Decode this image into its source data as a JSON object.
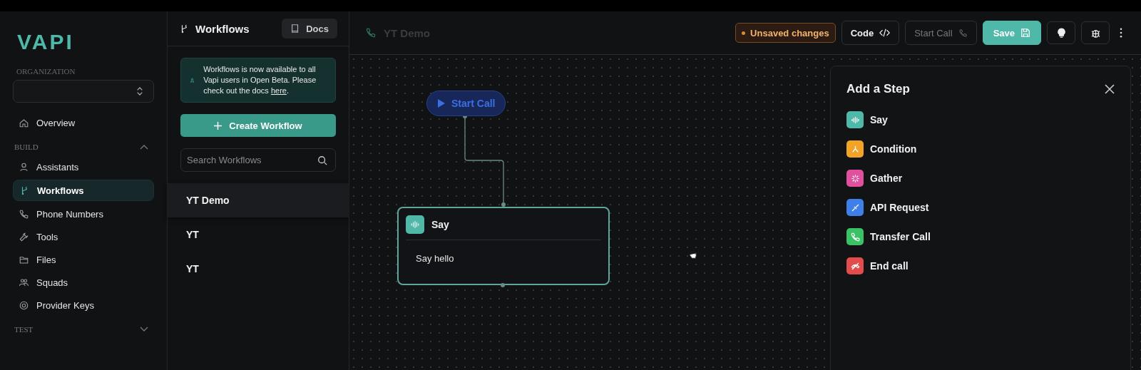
{
  "logo": "VAPI",
  "sidebar": {
    "organization_label": "ORGANIZATION",
    "top_items": [
      {
        "label": "Overview",
        "selected": false
      }
    ],
    "sections": [
      {
        "title": "BUILD",
        "expanded": true,
        "items": [
          {
            "label": "Assistants",
            "selected": false
          },
          {
            "label": "Workflows",
            "selected": true
          },
          {
            "label": "Phone Numbers",
            "selected": false
          },
          {
            "label": "Tools",
            "selected": false
          },
          {
            "label": "Files",
            "selected": false
          },
          {
            "label": "Squads",
            "selected": false
          },
          {
            "label": "Provider Keys",
            "selected": false
          }
        ]
      },
      {
        "title": "TEST",
        "expanded": false
      }
    ]
  },
  "workflows_panel": {
    "title": "Workflows",
    "docs_button": "Docs",
    "notice": {
      "text": "Workflows is now available to all Vapi users in Open Beta. Please check out the docs ",
      "link": "here",
      "after": "."
    },
    "create_button": "Create Workflow",
    "search": {
      "placeholder": "Search Workflows"
    },
    "items": [
      {
        "label": "YT Demo",
        "selected": true
      },
      {
        "label": "YT",
        "selected": false
      },
      {
        "label": "YT",
        "selected": false
      }
    ]
  },
  "header": {
    "title": "YT Demo",
    "status": "Unsaved changes",
    "buttons": [
      {
        "label": "Code",
        "kind": "code",
        "disabled": false
      },
      {
        "label": "Start Call",
        "kind": "call",
        "disabled": true
      },
      {
        "label": "Save",
        "kind": "save",
        "disabled": false
      }
    ]
  },
  "canvas": {
    "start_node": {
      "label": "Start Call"
    },
    "say_node": {
      "title": "Say",
      "body": "Say hello"
    }
  },
  "add_step": {
    "title": "Add a Step",
    "steps": [
      {
        "label": "Say",
        "color": "#4fb8a8"
      },
      {
        "label": "Condition",
        "color": "#f2a428"
      },
      {
        "label": "Gather",
        "color": "#e0509e"
      },
      {
        "label": "API Request",
        "color": "#3f7fe8"
      },
      {
        "label": "Transfer Call",
        "color": "#3cc266"
      },
      {
        "label": "End call",
        "color": "#e24c4c"
      }
    ]
  }
}
